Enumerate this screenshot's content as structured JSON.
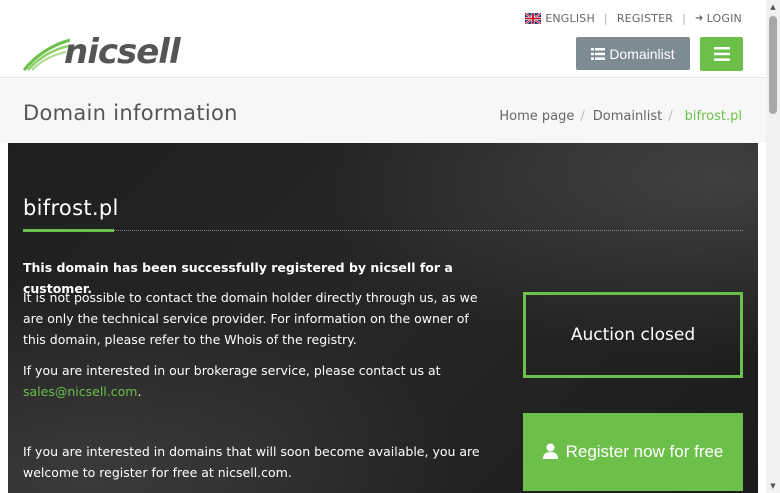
{
  "header": {
    "language_label": "ENGLISH",
    "register_label": "REGISTER",
    "login_label": "LOGIN",
    "logo_text": "nicsell",
    "domainlist_button": "Domainlist"
  },
  "page_header": {
    "title": "Domain information",
    "breadcrumb": [
      "Home page",
      "Domainlist",
      "bifrost.pl"
    ]
  },
  "content": {
    "domain": "bifrost.pl",
    "registered_notice": "This domain has been successfully registered by nicsell for a customer.",
    "contact_notice": "It is not possible to contact the domain holder directly through us, as we are only the technical service provider. For information on the owner of this domain, please refer to the Whois of the registry.",
    "brokerage_prefix": "If you are interested in our brokerage service, please contact us at",
    "brokerage_email": "sales@nicsell.com",
    "brokerage_suffix": ".",
    "register_notice": "If you are interested in domains that will soon become available, you are welcome to register for free at nicsell.com.",
    "auction_status": "Auction closed",
    "register_button": "Register now for free"
  },
  "colors": {
    "accent": "#6cc04a",
    "button_grey": "#7d8b93",
    "hero_bg": "#222222"
  }
}
